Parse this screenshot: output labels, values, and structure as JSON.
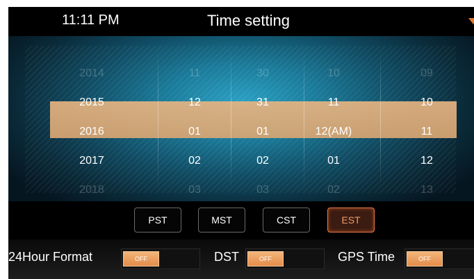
{
  "header": {
    "time": "11:11 PM",
    "title": "Time setting"
  },
  "picker": {
    "columns": [
      {
        "id": "year",
        "values": [
          "2014",
          "2015",
          "2016",
          "2017",
          "2018"
        ]
      },
      {
        "id": "month",
        "values": [
          "11",
          "12",
          "01",
          "02",
          "03"
        ]
      },
      {
        "id": "day",
        "values": [
          "30",
          "31",
          "01",
          "02",
          "03"
        ]
      },
      {
        "id": "hour",
        "values": [
          "10",
          "11",
          "12(AM)",
          "01",
          "02"
        ]
      },
      {
        "id": "minute",
        "values": [
          "09",
          "10",
          "11",
          "12",
          "13"
        ]
      }
    ]
  },
  "timezones": {
    "items": [
      {
        "label": "PST",
        "active": false
      },
      {
        "label": "MST",
        "active": false
      },
      {
        "label": "CST",
        "active": false
      },
      {
        "label": "EST",
        "active": true
      }
    ]
  },
  "options": {
    "hour24": {
      "label": "24Hour Format",
      "state": "OFF"
    },
    "dst": {
      "label": "DST",
      "state": "OFF"
    },
    "gps": {
      "label": "GPS Time",
      "state": "OFF"
    }
  },
  "colors": {
    "accent": "#e58c4a",
    "highlight": "#dcaa76",
    "background_center": "#2aa0c4"
  }
}
